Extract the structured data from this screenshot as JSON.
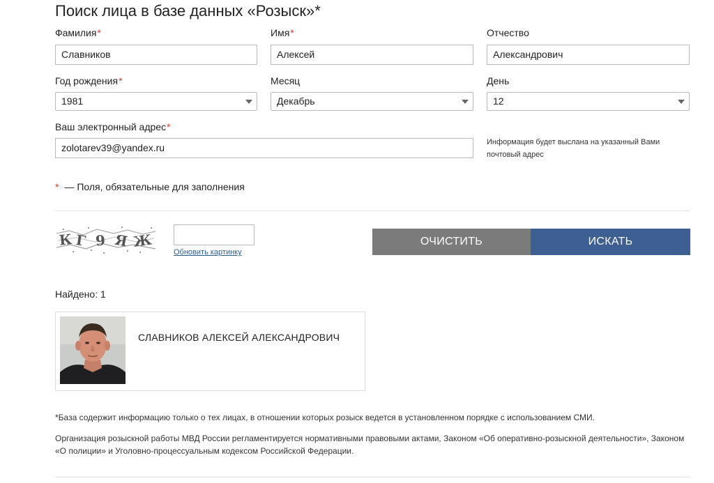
{
  "title": "Поиск лица в базе данных «Розыск»*",
  "required_mark": "*",
  "form": {
    "surname": {
      "label": "Фамилия",
      "value": "Славников"
    },
    "name": {
      "label": "Имя",
      "value": "Алексей"
    },
    "patronymic": {
      "label": "Отчество",
      "value": "Александрович"
    },
    "birth_year": {
      "label": "Год рождения",
      "value": "1981"
    },
    "month": {
      "label": "Месяц",
      "value": "Декабрь"
    },
    "day": {
      "label": "День",
      "value": "12"
    },
    "email": {
      "label": "Ваш электронный адрес",
      "value": "zolotarev39@yandex.ru"
    },
    "email_hint": "Информация будет выслана на указанный Вами почтовый адрес"
  },
  "required_note": "— Поля, обязательные для заполнения",
  "captcha": {
    "text": "КГ9ЯЖ",
    "refresh_label": "Обновить картинку",
    "input_value": ""
  },
  "buttons": {
    "clear": "ОЧИСТИТЬ",
    "search": "ИСКАТЬ"
  },
  "results": {
    "found_label": "Найдено: 1",
    "items": [
      {
        "name": "СЛАВНИКОВ АЛЕКСЕЙ АЛЕКСАНДРОВИЧ"
      }
    ]
  },
  "footnote": "*База содержит информацию только о тех лицах, в отношении которых розыск ведется в установленном порядке с использованием СМИ.",
  "law_text": "Организация розыскной работы МВД России регламентируется нормативными правовыми актами, Законом «Об оперативно-розыскной деятельности», Законом «О полиции» и Уголовно-процессуальным кодексом Российской Федерации.",
  "colors": {
    "required": "#d0402f",
    "clear_button": "#7b7b7b",
    "search_button": "#3d5f91",
    "link": "#2e5c8a"
  }
}
